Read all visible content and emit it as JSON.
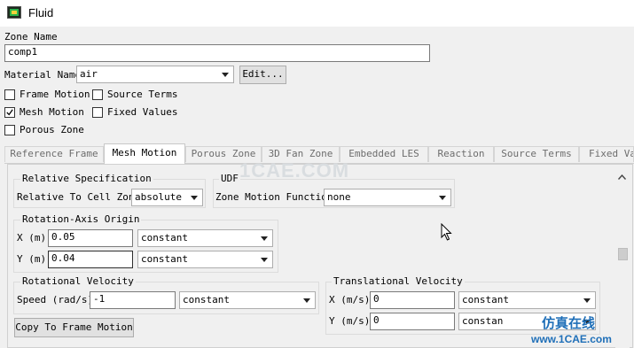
{
  "window": {
    "title": "Fluid",
    "icon": "fluent-app-icon"
  },
  "zone": {
    "label": "Zone Name",
    "value": "comp1"
  },
  "material": {
    "label": "Material Name",
    "value": "air",
    "edit_label": "Edit..."
  },
  "options": [
    {
      "label": "Frame Motion",
      "checked": false
    },
    {
      "label": "Source Terms",
      "checked": false
    },
    {
      "label": "Mesh Motion",
      "checked": true
    },
    {
      "label": "Fixed Values",
      "checked": false
    },
    {
      "label": "Porous Zone",
      "checked": false
    }
  ],
  "tabs": [
    "Reference Frame",
    "Mesh Motion",
    "Porous Zone",
    "3D Fan Zone",
    "Embedded LES",
    "Reaction",
    "Source Terms",
    "Fixed Val"
  ],
  "active_tab": "Mesh Motion",
  "relative_spec": {
    "title": "Relative Specification",
    "label": "Relative To Cell Zone",
    "value": "absolute"
  },
  "udf": {
    "title": "UDF",
    "label": "Zone Motion Function",
    "value": "none"
  },
  "rotation_origin": {
    "title": "Rotation-Axis Origin",
    "x": {
      "label": "X (m)",
      "value": "0.05",
      "mode": "constant"
    },
    "y": {
      "label": "Y (m)",
      "value": "0.04",
      "mode": "constant"
    }
  },
  "rotational_velocity": {
    "title": "Rotational Velocity",
    "label": "Speed (rad/s)",
    "value": "-1",
    "mode": "constant"
  },
  "translational_velocity": {
    "title": "Translational Velocity",
    "x": {
      "label": "X (m/s)",
      "value": "0",
      "mode": "constant"
    },
    "y": {
      "label": "Y (m/s)",
      "value": "0",
      "mode": "constan"
    }
  },
  "copy_button": "Copy To Frame Motion",
  "watermark": {
    "text": "1CAE.COM",
    "logo_cn": "仿真在线",
    "logo_url": "www.1CAE.com"
  }
}
